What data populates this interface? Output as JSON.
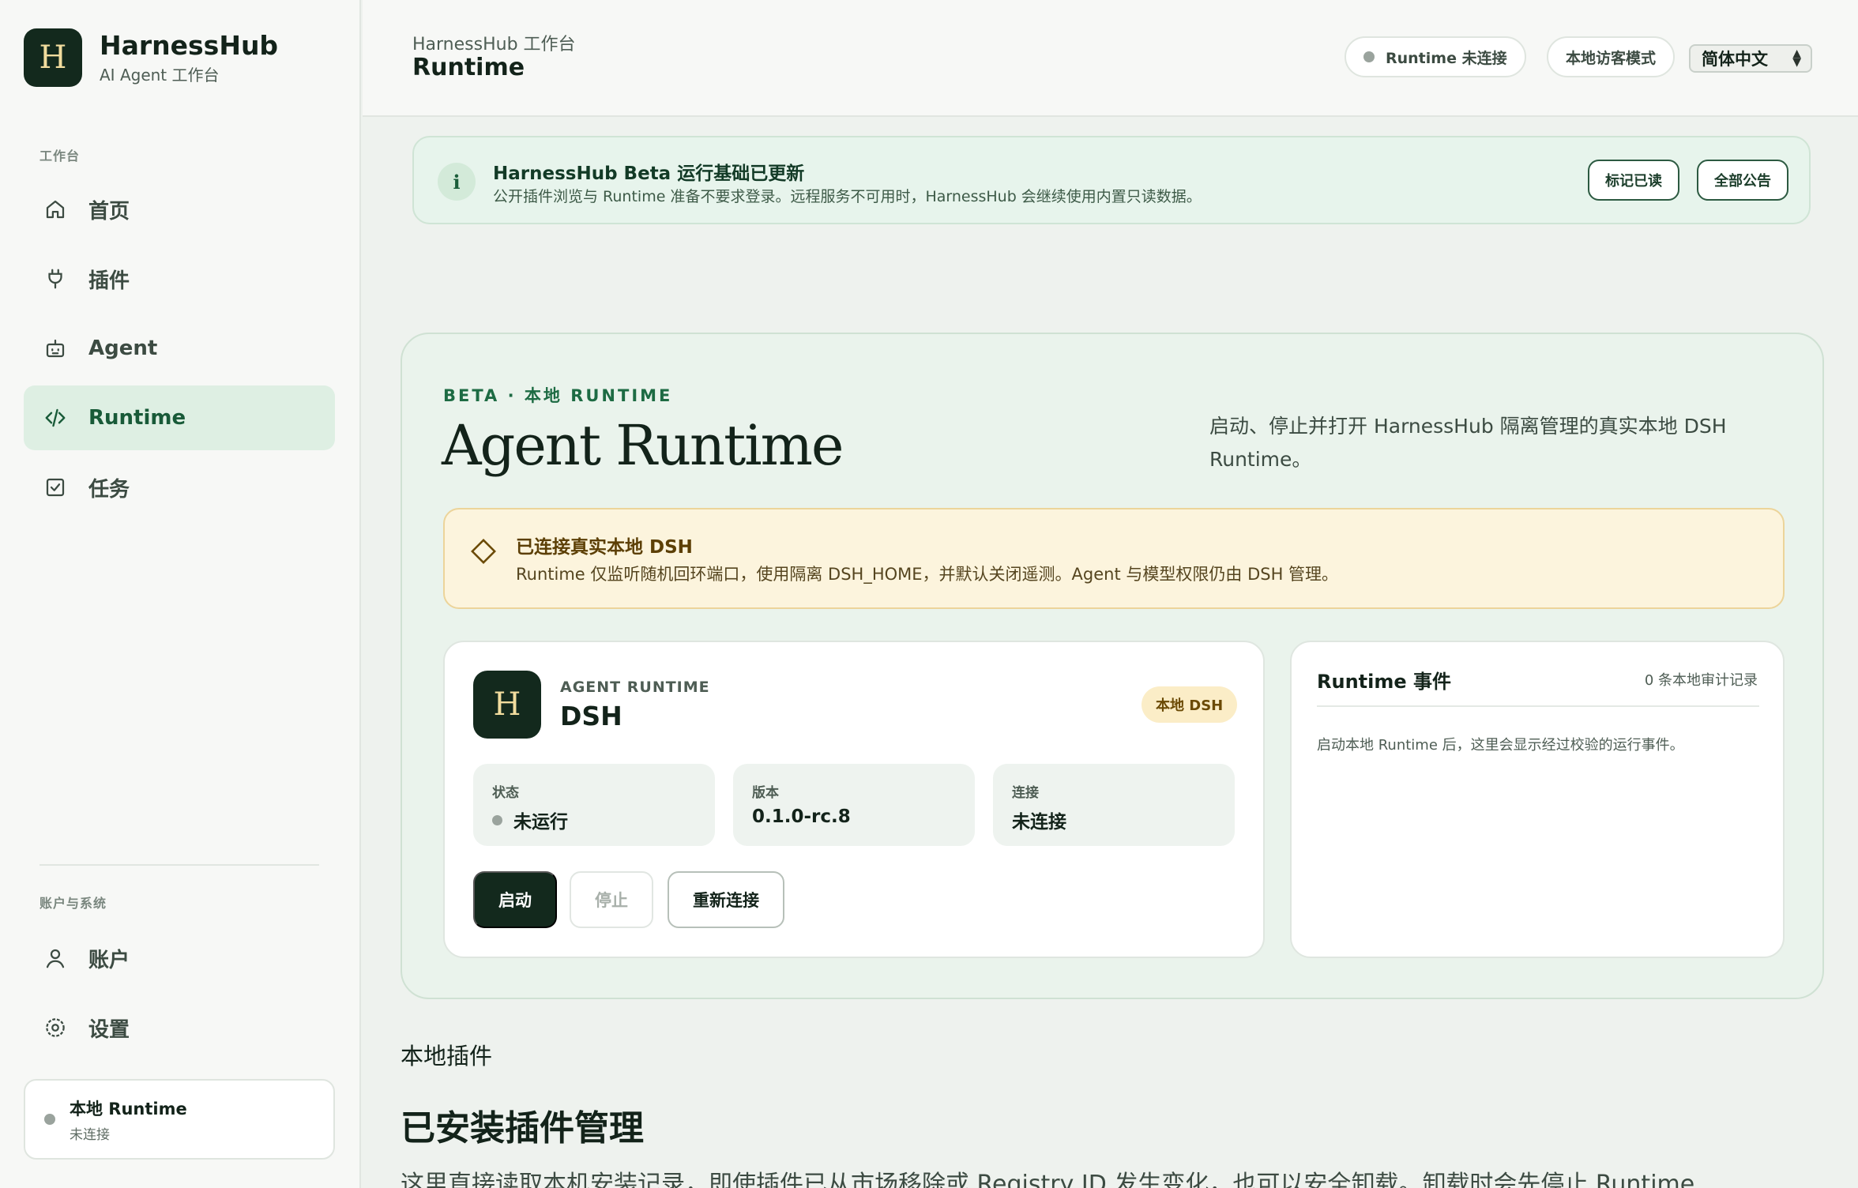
{
  "sidebar": {
    "brand": {
      "logo_letter": "H",
      "title": "HarnessHub",
      "subtitle": "AI Agent 工作台"
    },
    "section_workspace": "工作台",
    "nav": [
      {
        "label": "首页",
        "icon": "home-icon"
      },
      {
        "label": "插件",
        "icon": "plug-icon"
      },
      {
        "label": "Agent",
        "icon": "robot-icon"
      },
      {
        "label": "Runtime",
        "icon": "code-icon",
        "active": true
      },
      {
        "label": "任务",
        "icon": "checkbox-icon"
      }
    ],
    "section_account": "账户与系统",
    "account_nav": [
      {
        "label": "账户",
        "icon": "user-icon"
      },
      {
        "label": "设置",
        "icon": "gear-icon"
      }
    ],
    "runtime_status": {
      "title": "本地 Runtime",
      "subtitle": "未连接"
    }
  },
  "topbar": {
    "breadcrumb": "HarnessHub 工作台",
    "title": "Runtime",
    "runtime_pill": "Runtime 未连接",
    "guest_pill": "本地访客模式",
    "language": "简体中文"
  },
  "banner": {
    "icon": "info-icon",
    "title": "HarnessHub Beta 运行基础已更新",
    "body": "公开插件浏览与 Runtime 准备不要求登录。远程服务不可用时，HarnessHub 会继续使用内置只读数据。",
    "mark_read": "标记已读",
    "all_notices": "全部公告"
  },
  "runtime": {
    "eyebrow": "BETA · 本地 RUNTIME",
    "title": "Agent Runtime",
    "description": "启动、停止并打开 HarnessHub 隔离管理的真实本地 DSH Runtime。",
    "notice": {
      "title": "已连接真实本地 DSH",
      "body": "Runtime 仅监听随机回环端口，使用隔离 DSH_HOME，并默认关闭遥测。Agent 与模型权限仍由 DSH 管理。"
    },
    "card": {
      "logo_letter": "H",
      "eyebrow": "AGENT RUNTIME",
      "name": "DSH",
      "badge": "本地 DSH",
      "stats": [
        {
          "label": "状态",
          "value": "未运行"
        },
        {
          "label": "版本",
          "value": "0.1.0-rc.8"
        },
        {
          "label": "连接",
          "value": "未连接"
        }
      ],
      "start": "启动",
      "stop": "停止",
      "reconnect": "重新连接"
    },
    "events": {
      "title": "Runtime 事件",
      "count": "0 条本地审计记录",
      "empty": "启动本地 Runtime 后，这里会显示经过校验的运行事件。"
    }
  },
  "plugins_section": {
    "eyebrow": "本地插件",
    "title": "已安装插件管理",
    "body": "这里直接读取本机安装记录，即使插件已从市场移除或 Registry ID 发生变化，也可以安全卸载。卸载时会先停止 Runtime"
  }
}
